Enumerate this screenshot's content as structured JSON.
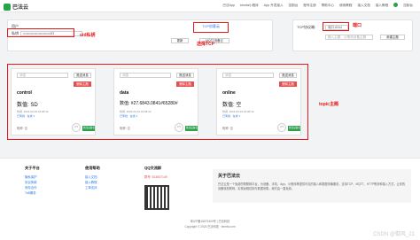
{
  "app": {
    "logo_text": "巴法云"
  },
  "nav": {
    "items": [
      "巴法App",
      "bemfa小程序",
      "App 开发接入",
      "控制台",
      "账号注册",
      "帮助中心",
      "使用教程",
      "接入文档",
      "接入教程",
      "控制台"
    ]
  },
  "uid_panel": {
    "user_label": "用户",
    "user_value": "",
    "key_label": "私钥",
    "key_value": "••••••••••••••••••••••••4f3",
    "tcp_tab_label": "TCP创客云",
    "btn_manage": "更新",
    "btn_mqtt": "MQTT设备云"
  },
  "port_panel": {
    "label": "TCP协议端:",
    "port_value": "端口:8344",
    "search_placeholder": "输入主题，以筛选设备主题",
    "btn_new": "新建主题"
  },
  "annotations": {
    "uid": "uid私钥",
    "tcp": "选择TCP",
    "port": "端口",
    "topic": "topic主题"
  },
  "cards": [
    {
      "topic_placeholder": "消息",
      "btn_send": "推送消息",
      "btn_delete": "删除主题",
      "title": "control",
      "data_text": "数值: SD",
      "meta1": "时间: 2024-04-19 16:05:42",
      "meta2": "已离线 · 在线 1",
      "hint": "昵称: 空",
      "badge": "270",
      "btn_rename": "修改设备名"
    },
    {
      "topic_placeholder": "消息",
      "btn_send": "推送消息",
      "btn_delete": "删除主题",
      "title": "data",
      "data_text": "数值: #27.6843.0841#65280#",
      "meta1": "时间: 2024-04-19 16:05:42",
      "meta2": "已离线 · 在线 1",
      "hint": "昵称: 空",
      "badge": "270",
      "btn_rename": "修改设备名"
    },
    {
      "topic_placeholder": "消息",
      "btn_send": "推送消息",
      "btn_delete": "删除主题",
      "title": "online",
      "data_text": "数值: 空",
      "meta1": "时间: 2024-04-19 16:05:42",
      "meta2": "已离线 · 在线 1",
      "hint": "昵称: 空",
      "badge": "270",
      "btn_rename": "修改设备名"
    }
  ],
  "footer": {
    "col1": {
      "title": "关于平台",
      "links": [
        "隐私保护",
        "协议条款",
        "商务合作",
        "ToB服务"
      ]
    },
    "col2": {
      "title": "使用帮助",
      "links": [
        "接入文档",
        "接入教程",
        "工单支持"
      ]
    },
    "col3": {
      "title": "QQ交流群",
      "qq": "群号: 513847149"
    },
    "about": {
      "title": "关于巴法云",
      "text": "巴法云是一个免费的物联网平台，为设备、手机、App、小程序等提供可靠的接入和数据传输服务，支持TCP、MQTT、HTTP等多种接入方式，让你的设备轻松联网，实现远程控制与数据采集，我们会一直免费。"
    },
    "icp": "粤ICP备18073400号 | 巴法科技",
    "copyright": "Copyright © 2024 巴法科技 · bemfa.com",
    "watermark": "CSDN @御风_21"
  }
}
